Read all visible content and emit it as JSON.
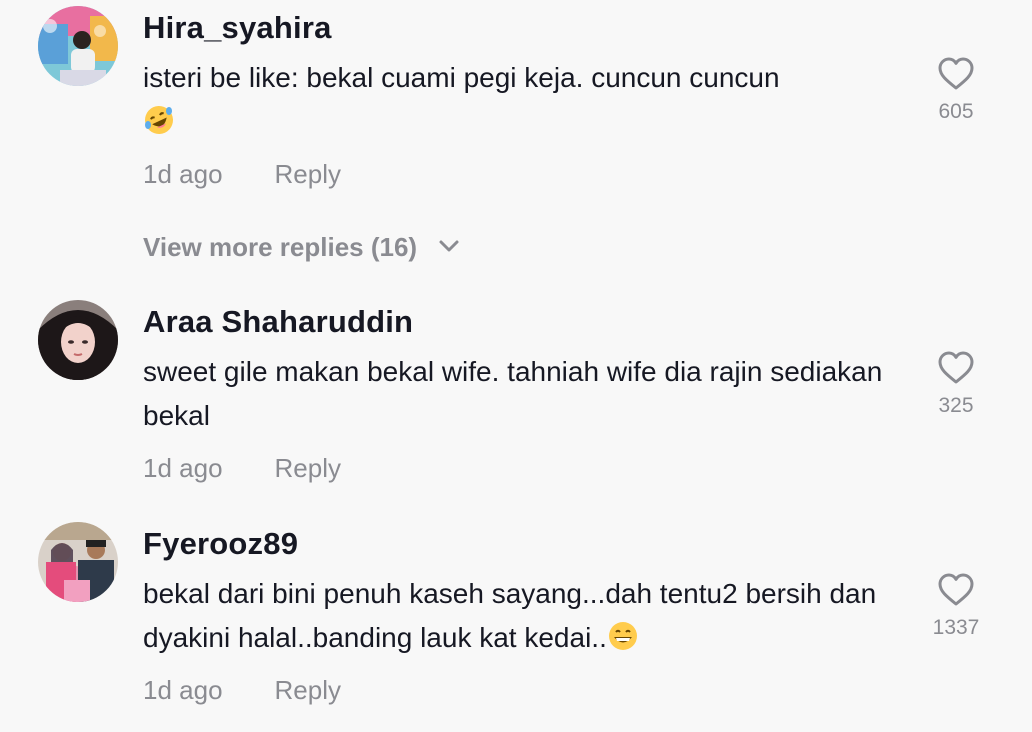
{
  "comments": [
    {
      "username": "Hira_syahira",
      "text": "isteri be like: bekal cuami pegi keja. cuncun cuncun",
      "emoji": "rolling-on-floor-laughing-emoji",
      "time": "1d ago",
      "reply_label": "Reply",
      "likes": "605",
      "view_more_replies": "View more replies (16)"
    },
    {
      "username": "Araa Shaharuddin",
      "text": "sweet gile makan bekal wife. tahniah wife dia rajin sediakan bekal",
      "time": "1d ago",
      "reply_label": "Reply",
      "likes": "325"
    },
    {
      "username": "Fyerooz89",
      "text": "bekal dari bini penuh kaseh sayang...dah tentu2 bersih dan dyakini halal..banding lauk kat kedai..",
      "emoji": "grinning-face-emoji",
      "time": "1d ago",
      "reply_label": "Reply",
      "likes": "1337"
    }
  ],
  "colors": {
    "background": "#f8f8f8",
    "primary_text": "#161823",
    "secondary_text": "#8a8b91",
    "emoji_yellow": "#ffcc4d"
  },
  "icons": {
    "like": "heart-outline-icon",
    "expand": "chevron-down-icon"
  }
}
